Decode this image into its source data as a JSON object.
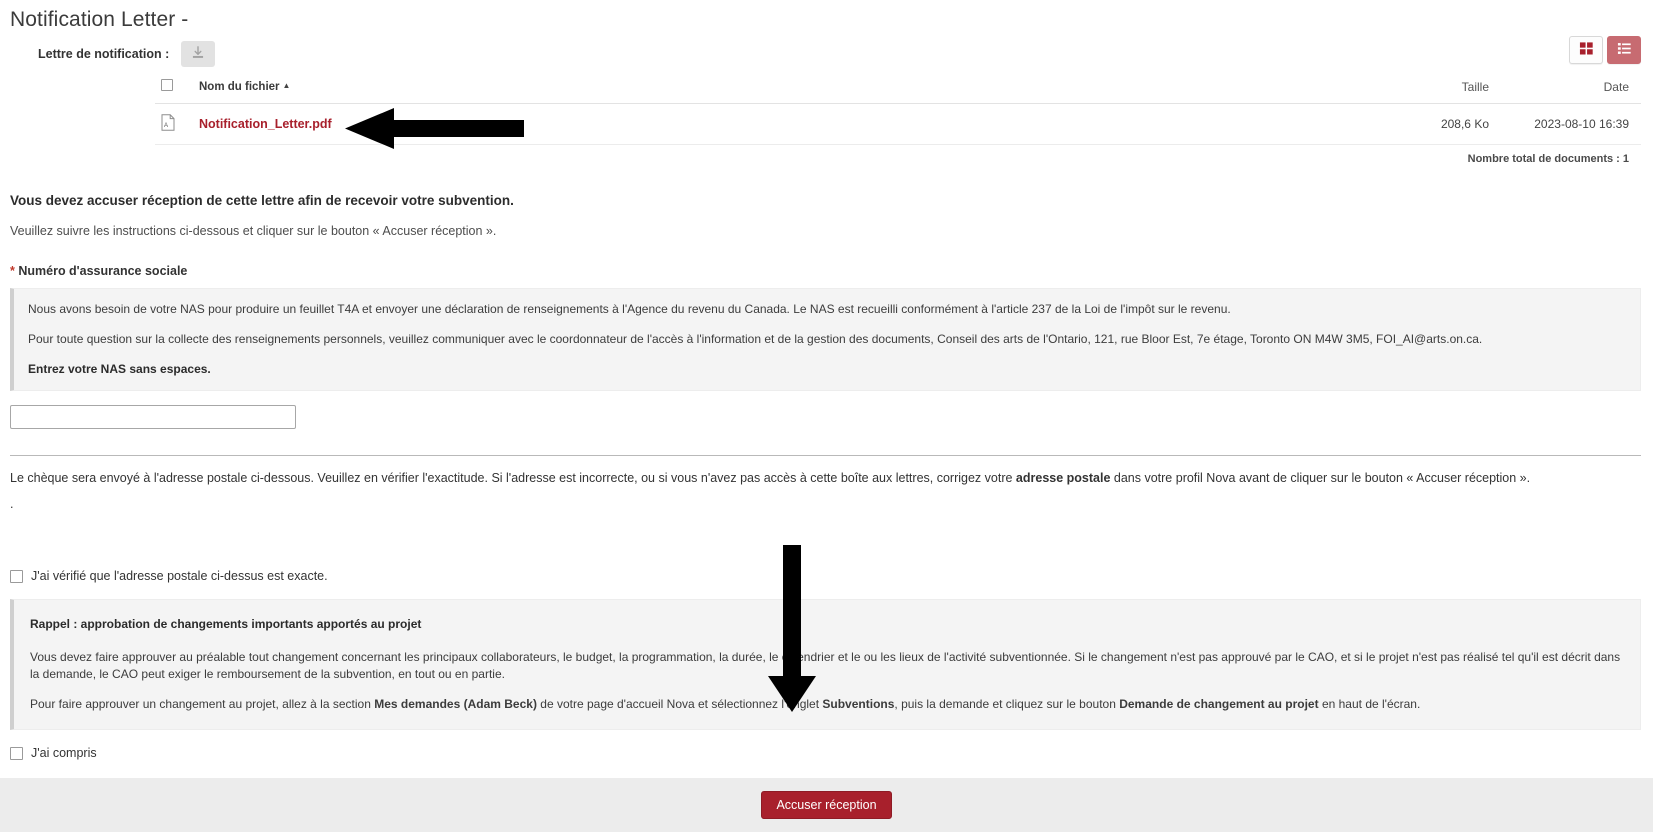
{
  "page": {
    "title": "Notification Letter -"
  },
  "toolbar": {
    "doc_label": "Lettre de notification :",
    "download_icon": "download-icon",
    "grid_view_icon": "grid-view-icon",
    "list_view_icon": "list-view-icon"
  },
  "file_table": {
    "columns": {
      "name": "Nom du fichier",
      "size": "Taille",
      "date": "Date"
    },
    "sort_caret": "▲",
    "rows": [
      {
        "icon": "pdf-file-icon",
        "name": "Notification_Letter.pdf",
        "size": "208,6 Ko",
        "date": "2023-08-10 16:39"
      }
    ],
    "total": "Nombre total de documents : 1"
  },
  "main": {
    "heading": "Vous devez accuser réception de cette lettre afin de recevoir votre subvention.",
    "subnote": "Veuillez suivre les instructions ci-dessous et cliquer sur le bouton « Accuser réception ».",
    "sin_label_required": "*",
    "sin_label": " Numéro d'assurance sociale",
    "sin_info": {
      "p1": "Nous avons besoin de votre NAS pour produire un feuillet T4A et envoyer une déclaration de renseignements à l'Agence du revenu du Canada. Le NAS est recueilli conformément à l'article 237 de la Loi de l'impôt sur le revenu.",
      "p2": "Pour toute question sur la collecte des renseignements personnels, veuillez communiquer avec le coordonnateur de l'accès à l'information et de la gestion des documents, Conseil des arts de l'Ontario, 121, rue Bloor Est, 7e étage, Toronto ON M4W 3M5, FOI_AI@arts.on.ca.",
      "p3": "Entrez votre NAS sans espaces."
    },
    "sin_input_value": "",
    "sin_input_placeholder": "",
    "address_para_1": "Le chèque sera envoyé à l'adresse postale ci-dessous. Veuillez en vérifier l'exactitude. Si l'adresse est incorrecte, ou si vous n'avez pas accès à cette boîte aux lettres, corrigez votre ",
    "address_para_bold": "adresse postale",
    "address_para_2": " dans votre profil Nova avant de cliquer sur le bouton « Accuser réception ».",
    "address_value": ".",
    "confirm_address_label": "J'ai vérifié que l'adresse postale ci-dessus est exacte.",
    "confirm_address_checked": false,
    "rappel": {
      "title": "Rappel : approbation de changements importants apportés au projet",
      "p1": "Vous devez faire approuver au préalable tout changement concernant les principaux collaborateurs, le budget, la programmation, la durée, le calendrier et le ou les lieux de l'activité subventionnée. Si le changement n'est pas approuvé par le CAO, et si le projet n'est pas réalisé tel qu'il est décrit dans la demande, le CAO peut exiger le remboursement de la subvention, en tout ou en partie.",
      "p2_a": "Pour faire approuver un changement au projet, allez à la section ",
      "p2_b1": "Mes demandes (Adam Beck)",
      "p2_c": " de votre page d'accueil Nova et sélectionnez l'onglet ",
      "p2_b2": "Subventions",
      "p2_d": ", puis la demande et cliquez sur le bouton ",
      "p2_b3": "Demande de changement au projet",
      "p2_e": " en haut de l'écran."
    },
    "understood_label": "J'ai compris",
    "understood_checked": false
  },
  "footer": {
    "submit_label": "Accuser réception"
  },
  "colors": {
    "accent_red": "#a8202c",
    "link_red": "#a8202c",
    "toggle_active": "#c76b71",
    "infobox_bg": "#f4f4f4",
    "footer_bg": "#ececec"
  },
  "annotations": {
    "arrow_horizontal": "left-pointing-arrow",
    "arrow_vertical": "down-pointing-arrow"
  }
}
